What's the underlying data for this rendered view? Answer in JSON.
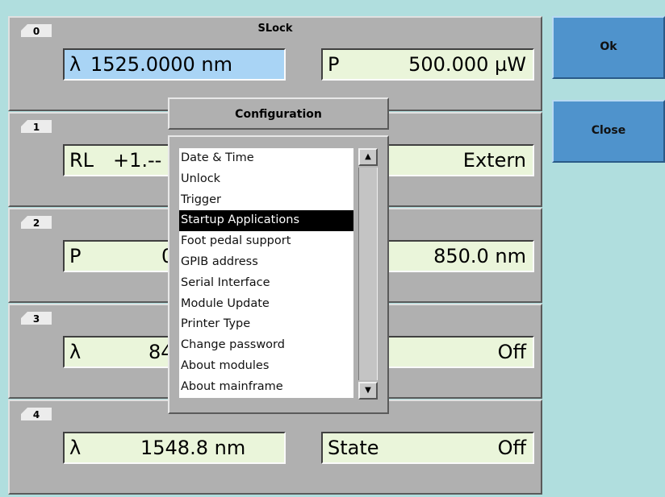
{
  "slots": [
    {
      "number": "0",
      "title": "SLock",
      "left": {
        "label": "λ",
        "value": "1525.0000 nm"
      },
      "right": {
        "label": "P",
        "value": "500.000 µW"
      }
    },
    {
      "number": "1",
      "title": "",
      "left": {
        "label": "RL",
        "value": "+1.--"
      },
      "right": {
        "label": "",
        "value": "Extern"
      }
    },
    {
      "number": "2",
      "title": "",
      "left": {
        "label": "P",
        "value": "0"
      },
      "right": {
        "label": "",
        "value": "850.0 nm"
      }
    },
    {
      "number": "3",
      "title": "",
      "left": {
        "label": "λ",
        "value": "84"
      },
      "right": {
        "label": "",
        "value": "Off"
      }
    },
    {
      "number": "4",
      "title": "",
      "left": {
        "label": "λ",
        "value": "1548.8 nm"
      },
      "right": {
        "label": "State",
        "value": "Off"
      }
    }
  ],
  "buttons": {
    "ok": "Ok",
    "close": "Close"
  },
  "dialog": {
    "title": "Configuration",
    "items": [
      "Date & Time",
      "Unlock",
      "Trigger",
      "Startup Applications",
      "Foot pedal support",
      "GPIB address",
      "Serial Interface",
      "Module Update",
      "Printer Type",
      "Change password",
      "About modules",
      "About mainframe"
    ],
    "selected_index": 3
  },
  "scroll": {
    "up": "▲",
    "down": "▼"
  }
}
